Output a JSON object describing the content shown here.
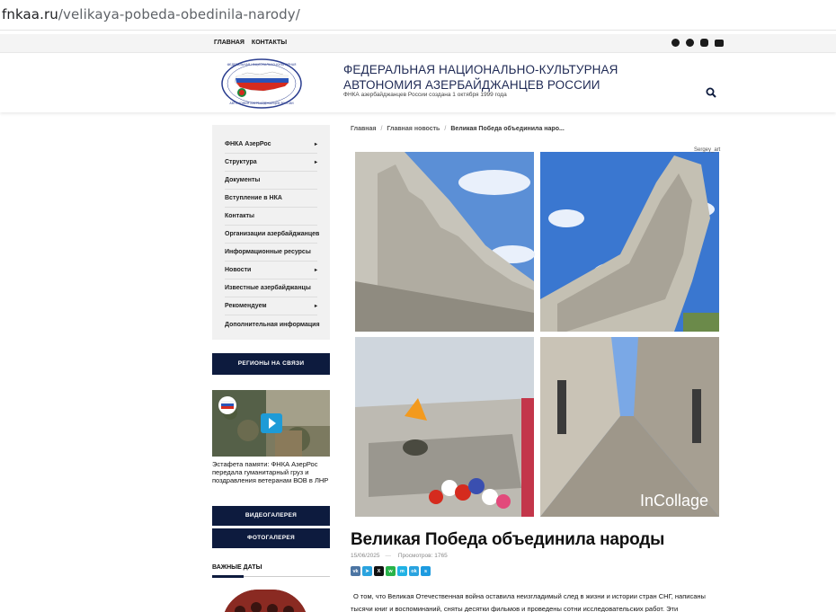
{
  "browser": {
    "url_domain": "fnkaa.ru",
    "url_path": "/velikaya-pobeda-obedinila-narody/"
  },
  "topnav": {
    "home": "ГЛАВНАЯ",
    "contacts": "КОНТАКТЫ"
  },
  "social": [
    "facebook-icon",
    "telegram-icon",
    "instagram-icon",
    "youtube-icon"
  ],
  "header": {
    "title": "ФЕДЕРАЛЬНАЯ НАЦИОНАЛЬНО-КУЛЬТУРНАЯ АВТОНОМИЯ АЗЕРБАЙДЖАНЦЕВ РОССИИ",
    "subtitle": "ФНКА азербайджанцев России создана 1 октября 1999 года",
    "logo_text": "ФЕДЕРАЛЬНАЯ НАЦИОНАЛЬНО-КУЛЬТУРНАЯ АВТОНОМИЯ АЗЕРБАЙДЖАНЦЕВ РОССИИ"
  },
  "sidebar": {
    "menu": [
      {
        "label": "ФНКА АзерРос",
        "has_sub": true
      },
      {
        "label": "Структура",
        "has_sub": true
      },
      {
        "label": "Документы",
        "has_sub": false
      },
      {
        "label": "Вступление в НКА",
        "has_sub": false
      },
      {
        "label": "Контакты",
        "has_sub": false
      },
      {
        "label": "Организации азербайджанцев",
        "has_sub": false
      },
      {
        "label": "Информационные ресурсы",
        "has_sub": false
      },
      {
        "label": "Новости",
        "has_sub": true
      },
      {
        "label": "Известные азербайджанцы",
        "has_sub": false
      },
      {
        "label": "Рекомендуем",
        "has_sub": true
      },
      {
        "label": "Дополнительная информация",
        "has_sub": false
      }
    ],
    "regions_button": "РЕГИОНЫ НА СВЯЗИ",
    "video_caption": "Эстафета памяти: ФНКА АзерРос передала гуманитарный груз и поздравления ветеранам ВОВ в ЛНР",
    "video_gallery_button": "ВИДЕОГАЛЕРЕЯ",
    "photo_gallery_button": "ФОТОГАЛЕРЕЯ",
    "dates_title": "ВАЖНЫЕ ДАТЫ"
  },
  "article": {
    "breadcrumb": [
      "Главная",
      "Главная новость",
      "Великая Победа объединила наро..."
    ],
    "image_watermark": "Sergey_art",
    "collage_brand": "InCollage",
    "title": "Великая Победа объединила народы",
    "date": "15/06/2025",
    "views": "Просмотров: 1765",
    "share": [
      "vk-icon",
      "telegram-icon",
      "x-icon",
      "whatsapp-icon",
      "messenger-icon",
      "ok-icon",
      "skype-icon"
    ],
    "body_line1": "О том, что Великая Отечественная война оставила неизгладимый след в жизни и истории стран СНГ, написаны",
    "body_line2": "тысячи книг и воспоминаний, сняты десятки фильмов и проведены сотни исследовательских работ. Эти"
  },
  "colors": {
    "navy": "#0d1b3e",
    "title_blue": "#1f2a55",
    "sidebar_bg": "#f1f1f1"
  }
}
